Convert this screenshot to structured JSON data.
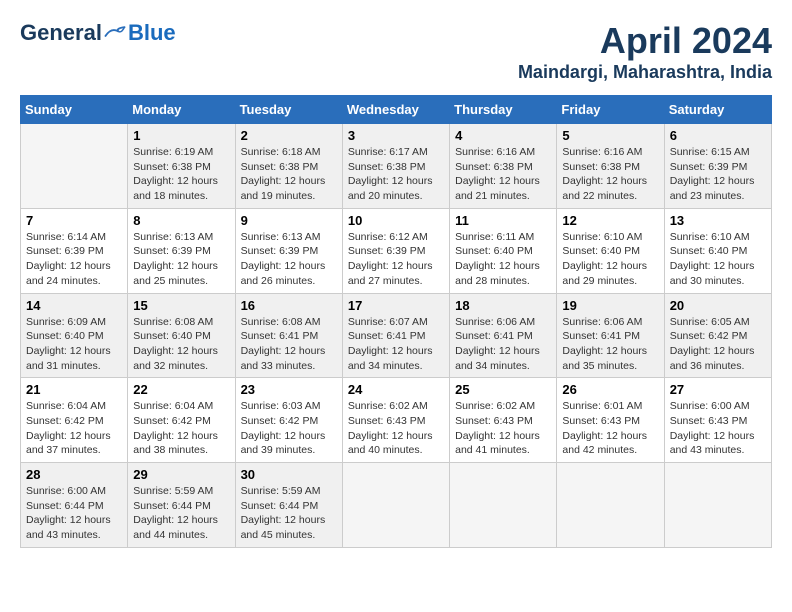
{
  "logo": {
    "general": "General",
    "blue": "Blue"
  },
  "title": "April 2024",
  "subtitle": "Maindargi, Maharashtra, India",
  "weekdays": [
    "Sunday",
    "Monday",
    "Tuesday",
    "Wednesday",
    "Thursday",
    "Friday",
    "Saturday"
  ],
  "weeks": [
    [
      {
        "day": "",
        "empty": true
      },
      {
        "day": "1",
        "sunrise": "6:19 AM",
        "sunset": "6:38 PM",
        "daylight": "12 hours and 18 minutes."
      },
      {
        "day": "2",
        "sunrise": "6:18 AM",
        "sunset": "6:38 PM",
        "daylight": "12 hours and 19 minutes."
      },
      {
        "day": "3",
        "sunrise": "6:17 AM",
        "sunset": "6:38 PM",
        "daylight": "12 hours and 20 minutes."
      },
      {
        "day": "4",
        "sunrise": "6:16 AM",
        "sunset": "6:38 PM",
        "daylight": "12 hours and 21 minutes."
      },
      {
        "day": "5",
        "sunrise": "6:16 AM",
        "sunset": "6:38 PM",
        "daylight": "12 hours and 22 minutes."
      },
      {
        "day": "6",
        "sunrise": "6:15 AM",
        "sunset": "6:39 PM",
        "daylight": "12 hours and 23 minutes."
      }
    ],
    [
      {
        "day": "7",
        "sunrise": "6:14 AM",
        "sunset": "6:39 PM",
        "daylight": "12 hours and 24 minutes."
      },
      {
        "day": "8",
        "sunrise": "6:13 AM",
        "sunset": "6:39 PM",
        "daylight": "12 hours and 25 minutes."
      },
      {
        "day": "9",
        "sunrise": "6:13 AM",
        "sunset": "6:39 PM",
        "daylight": "12 hours and 26 minutes."
      },
      {
        "day": "10",
        "sunrise": "6:12 AM",
        "sunset": "6:39 PM",
        "daylight": "12 hours and 27 minutes."
      },
      {
        "day": "11",
        "sunrise": "6:11 AM",
        "sunset": "6:40 PM",
        "daylight": "12 hours and 28 minutes."
      },
      {
        "day": "12",
        "sunrise": "6:10 AM",
        "sunset": "6:40 PM",
        "daylight": "12 hours and 29 minutes."
      },
      {
        "day": "13",
        "sunrise": "6:10 AM",
        "sunset": "6:40 PM",
        "daylight": "12 hours and 30 minutes."
      }
    ],
    [
      {
        "day": "14",
        "sunrise": "6:09 AM",
        "sunset": "6:40 PM",
        "daylight": "12 hours and 31 minutes."
      },
      {
        "day": "15",
        "sunrise": "6:08 AM",
        "sunset": "6:40 PM",
        "daylight": "12 hours and 32 minutes."
      },
      {
        "day": "16",
        "sunrise": "6:08 AM",
        "sunset": "6:41 PM",
        "daylight": "12 hours and 33 minutes."
      },
      {
        "day": "17",
        "sunrise": "6:07 AM",
        "sunset": "6:41 PM",
        "daylight": "12 hours and 34 minutes."
      },
      {
        "day": "18",
        "sunrise": "6:06 AM",
        "sunset": "6:41 PM",
        "daylight": "12 hours and 34 minutes."
      },
      {
        "day": "19",
        "sunrise": "6:06 AM",
        "sunset": "6:41 PM",
        "daylight": "12 hours and 35 minutes."
      },
      {
        "day": "20",
        "sunrise": "6:05 AM",
        "sunset": "6:42 PM",
        "daylight": "12 hours and 36 minutes."
      }
    ],
    [
      {
        "day": "21",
        "sunrise": "6:04 AM",
        "sunset": "6:42 PM",
        "daylight": "12 hours and 37 minutes."
      },
      {
        "day": "22",
        "sunrise": "6:04 AM",
        "sunset": "6:42 PM",
        "daylight": "12 hours and 38 minutes."
      },
      {
        "day": "23",
        "sunrise": "6:03 AM",
        "sunset": "6:42 PM",
        "daylight": "12 hours and 39 minutes."
      },
      {
        "day": "24",
        "sunrise": "6:02 AM",
        "sunset": "6:43 PM",
        "daylight": "12 hours and 40 minutes."
      },
      {
        "day": "25",
        "sunrise": "6:02 AM",
        "sunset": "6:43 PM",
        "daylight": "12 hours and 41 minutes."
      },
      {
        "day": "26",
        "sunrise": "6:01 AM",
        "sunset": "6:43 PM",
        "daylight": "12 hours and 42 minutes."
      },
      {
        "day": "27",
        "sunrise": "6:00 AM",
        "sunset": "6:43 PM",
        "daylight": "12 hours and 43 minutes."
      }
    ],
    [
      {
        "day": "28",
        "sunrise": "6:00 AM",
        "sunset": "6:44 PM",
        "daylight": "12 hours and 43 minutes."
      },
      {
        "day": "29",
        "sunrise": "5:59 AM",
        "sunset": "6:44 PM",
        "daylight": "12 hours and 44 minutes."
      },
      {
        "day": "30",
        "sunrise": "5:59 AM",
        "sunset": "6:44 PM",
        "daylight": "12 hours and 45 minutes."
      },
      {
        "day": "",
        "empty": true
      },
      {
        "day": "",
        "empty": true
      },
      {
        "day": "",
        "empty": true
      },
      {
        "day": "",
        "empty": true
      }
    ]
  ]
}
